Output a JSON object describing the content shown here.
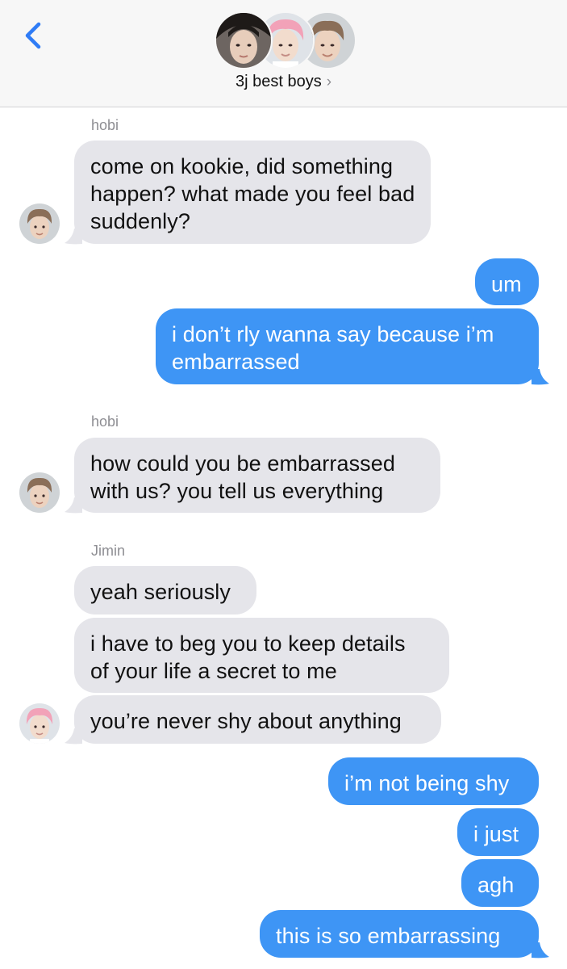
{
  "header": {
    "title": "3j best boys",
    "chevron": "›",
    "back_icon": "chevron-left-icon",
    "accent": "#2f7cf6"
  },
  "colors": {
    "incoming_bubble": "#e5e5ea",
    "outgoing_bubble": "#3e95f5",
    "sender_name": "#8e8e93"
  },
  "messages": {
    "m1": {
      "sender": "hobi",
      "text": "come on kookie, did something\nhappen? what made you feel bad\nsuddenly?"
    },
    "m2": {
      "text": "um"
    },
    "m3": {
      "text": "i don’t rly wanna say because i’m\nembarrassed"
    },
    "m4": {
      "sender": "hobi",
      "text": "how could you be embarrassed\nwith us? you tell us everything"
    },
    "m5": {
      "sender": "Jimin",
      "text": "yeah seriously"
    },
    "m6": {
      "text": "i have to beg you to keep details\nof your life a secret to me"
    },
    "m7": {
      "text": "you’re never shy about anything"
    },
    "m8": {
      "text": "i’m not being shy"
    },
    "m9": {
      "text": "i just"
    },
    "m10": {
      "text": "agh"
    },
    "m11": {
      "text": "this is so embarrassing"
    }
  }
}
